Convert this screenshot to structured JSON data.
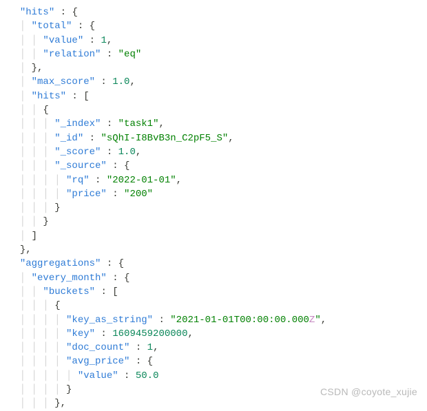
{
  "line1": {
    "k1": "\"hits\"",
    "p": " : {"
  },
  "line2": {
    "k1": "\"total\"",
    "p": " : {"
  },
  "line3": {
    "k1": "\"value\"",
    "c": " : ",
    "v": "1",
    "t": ","
  },
  "line4": {
    "k1": "\"relation\"",
    "c": " : ",
    "v": "\"eq\""
  },
  "line5": {
    "p": "},"
  },
  "line6": {
    "k1": "\"max_score\"",
    "c": " : ",
    "v": "1.0",
    "t": ","
  },
  "line7": {
    "k1": "\"hits\"",
    "p": " : ["
  },
  "line8": {
    "p": "{"
  },
  "line9": {
    "k1": "\"_index\"",
    "c": " : ",
    "v": "\"task1\"",
    "t": ","
  },
  "line10": {
    "k1": "\"_id\"",
    "c": " : ",
    "v": "\"sQhI-I8BvB3n_C2pF5_S\"",
    "t": ","
  },
  "line11": {
    "k1": "\"_score\"",
    "c": " : ",
    "v": "1.0",
    "t": ","
  },
  "line12": {
    "k1": "\"_source\"",
    "p": " : {"
  },
  "line13": {
    "k1": "\"rq\"",
    "c": " : ",
    "v": "\"2022-01-01\"",
    "t": ","
  },
  "line14": {
    "k1": "\"price\"",
    "c": " : ",
    "v": "\"200\""
  },
  "line15": {
    "p": "}"
  },
  "line16": {
    "p": "}"
  },
  "line17": {
    "p": "]"
  },
  "line18": {
    "p": "},"
  },
  "line19": {
    "k1": "\"aggregations\"",
    "p": " : {"
  },
  "line20": {
    "k1": "\"every_month\"",
    "p": " : {"
  },
  "line21": {
    "k1": "\"buckets\"",
    "p": " : ["
  },
  "line22": {
    "p": "{"
  },
  "line23": {
    "k1": "\"key_as_string\"",
    "c": " : ",
    "v": "\"2021-01-01T00:00:00.000",
    "z": "Z",
    "q": "\"",
    "t": ","
  },
  "line24": {
    "k1": "\"key\"",
    "c": " : ",
    "v": "1609459200000",
    "t": ","
  },
  "line25": {
    "k1": "\"doc_count\"",
    "c": " : ",
    "v": "1",
    "t": ","
  },
  "line26": {
    "k1": "\"avg_price\"",
    "p": " : {"
  },
  "line27": {
    "k1": "\"value\"",
    "c": " : ",
    "v": "50.0"
  },
  "line28": {
    "p": "}"
  },
  "line29": {
    "p": "},"
  },
  "watermark": "CSDN @coyote_xujie"
}
